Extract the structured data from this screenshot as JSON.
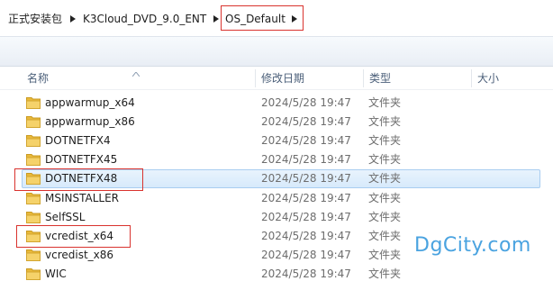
{
  "breadcrumb": {
    "items": [
      "正式安装包",
      "K3Cloud_DVD_9.0_ENT",
      "OS_Default"
    ]
  },
  "columns": {
    "name": "名称",
    "modified": "修改日期",
    "type": "类型",
    "size": "大小"
  },
  "files": [
    {
      "name": "appwarmup_x64",
      "modified": "2024/5/28 19:47",
      "type": "文件夹"
    },
    {
      "name": "appwarmup_x86",
      "modified": "2024/5/28 19:47",
      "type": "文件夹"
    },
    {
      "name": "DOTNETFX4",
      "modified": "2024/5/28 19:47",
      "type": "文件夹"
    },
    {
      "name": "DOTNETFX45",
      "modified": "2024/5/28 19:47",
      "type": "文件夹"
    },
    {
      "name": "DOTNETFX48",
      "modified": "2024/5/28 19:47",
      "type": "文件夹",
      "selected": true
    },
    {
      "name": "MSINSTALLER",
      "modified": "2024/5/28 19:47",
      "type": "文件夹"
    },
    {
      "name": "SelfSSL",
      "modified": "2024/5/28 19:47",
      "type": "文件夹"
    },
    {
      "name": "vcredist_x64",
      "modified": "2024/5/28 19:47",
      "type": "文件夹"
    },
    {
      "name": "vcredist_x86",
      "modified": "2024/5/28 19:47",
      "type": "文件夹"
    },
    {
      "name": "WIC",
      "modified": "2024/5/28 19:47",
      "type": "文件夹"
    }
  ],
  "watermark": "DgCity.com",
  "colors": {
    "highlight": "#d9332e",
    "selection": "#d7eafb",
    "folder": "#f2c94c",
    "header_text": "#4c607a",
    "watermark": "#4aa3e0"
  }
}
